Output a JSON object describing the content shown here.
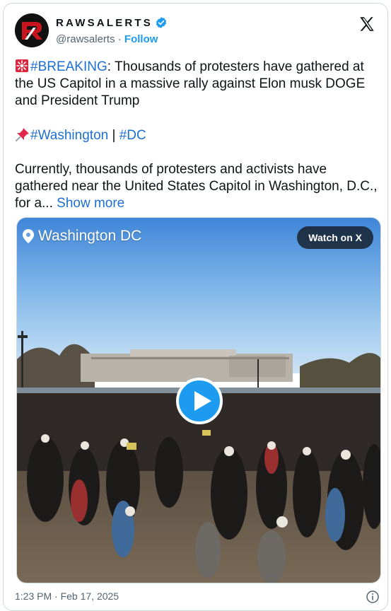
{
  "account": {
    "display_name": "RAWSALERTS",
    "handle": "@rawsalerts",
    "separator": "·",
    "follow_label": "Follow"
  },
  "tweet": {
    "breaking_tag": "#BREAKING",
    "breaking_text": ": Thousands of protesters have gathered at the US Capitol in a massive rally against Elon musk DOGE and President Trump",
    "hashtag_washington": "#Washington",
    "hashtag_sep": " | ",
    "hashtag_dc": "#DC",
    "body_text": "Currently, thousands of protesters and activists have gathered near the United States Capitol in Washington, D.C., for a... ",
    "show_more_label": "Show more"
  },
  "video": {
    "location_label": "Washington DC",
    "watch_label": "Watch on X"
  },
  "footer": {
    "timestamp": "1:23 PM · Feb 17, 2025"
  },
  "icons": {
    "verified": "verified-badge-icon",
    "x_logo": "x-logo-icon",
    "location": "location-pin-icon",
    "play": "play-icon",
    "info": "info-icon"
  },
  "colors": {
    "link": "#1d9bf0",
    "text": "#0f1419",
    "secondary": "#536471",
    "border": "#cfd9de"
  }
}
